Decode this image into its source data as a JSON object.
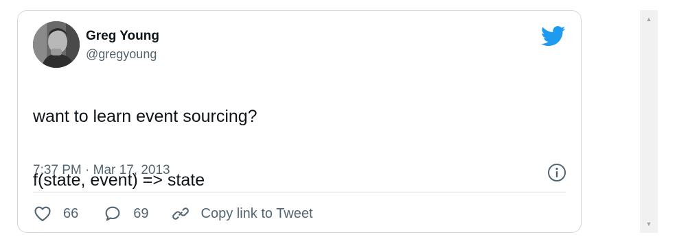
{
  "tweet": {
    "author": {
      "display_name": "Greg Young",
      "handle": "@gregyoung",
      "avatar_icon": "avatar-photo"
    },
    "text_lines": [
      "want to learn event sourcing?",
      "f(state, event) => state"
    ],
    "timestamp": "7:37 PM · Mar 17, 2013",
    "actions": {
      "like_count": "66",
      "reply_count": "69",
      "copy_link_label": "Copy link to Tweet"
    }
  },
  "colors": {
    "brand": "#1d9bf0",
    "border": "#cfd9de",
    "secondary_text": "#536471",
    "primary_text": "#0f1419"
  },
  "icons": [
    "twitter-bird-icon",
    "info-icon",
    "heart-icon",
    "reply-bubble-icon",
    "link-icon",
    "scroll-up-arrow",
    "scroll-down-arrow"
  ]
}
